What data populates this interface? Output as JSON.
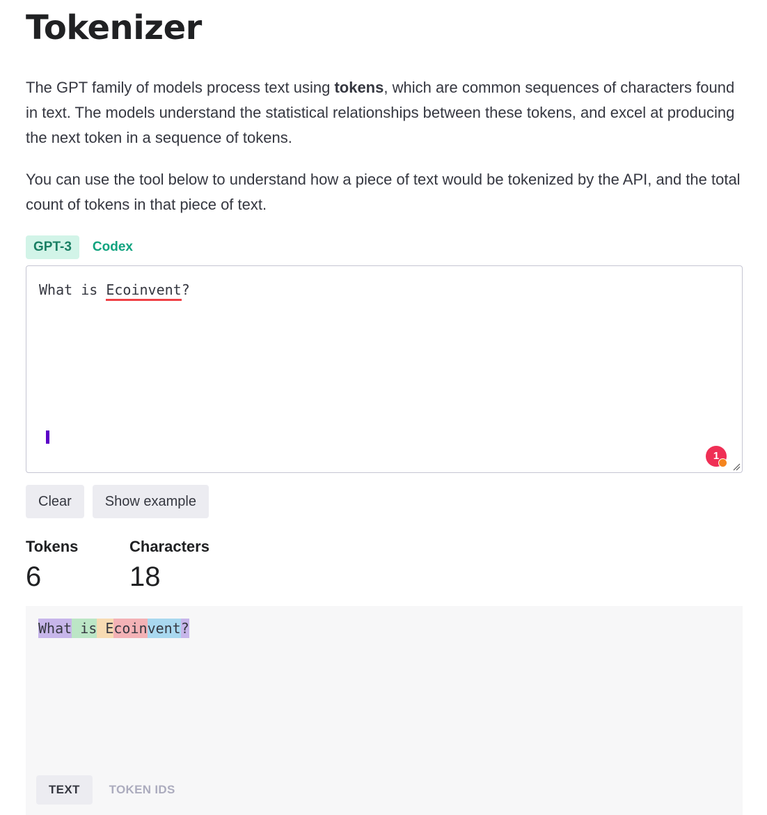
{
  "header": {
    "title": "Tokenizer"
  },
  "intro": {
    "p1_before": "The GPT family of models process text using ",
    "p1_bold": "tokens",
    "p1_after": ", which are common sequences of characters found in text. The models understand the statistical relationships between these tokens, and excel at producing the next token in a sequence of tokens.",
    "p2": "You can use the tool below to understand how a piece of text would be tokenized by the API, and the total count of tokens in that piece of text."
  },
  "model_tabs": [
    {
      "label": "GPT-3",
      "active": true
    },
    {
      "label": "Codex",
      "active": false
    }
  ],
  "editor": {
    "text_before": "What is ",
    "text_flagged": "Ecoinvent",
    "text_after": "?",
    "grammar_badge_count": "1"
  },
  "buttons": {
    "clear": "Clear",
    "show_example": "Show example"
  },
  "stats": {
    "tokens_label": "Tokens",
    "tokens_value": "6",
    "characters_label": "Characters",
    "characters_value": "18"
  },
  "output": {
    "tokens": [
      {
        "text": "What",
        "color": "#c7b6ea"
      },
      {
        "text": " is",
        "color": "#bce6c6"
      },
      {
        "text": " E",
        "color": "#f7dbb3"
      },
      {
        "text": "coin",
        "color": "#f3b2b6"
      },
      {
        "text": "vent",
        "color": "#a9d8ef"
      },
      {
        "text": "?",
        "color": "#c7b6ea"
      }
    ],
    "view_tabs": [
      {
        "label": "TEXT",
        "active": true
      },
      {
        "label": "TOKEN IDS",
        "active": false
      }
    ]
  },
  "colors": {
    "accent": "#10a37f",
    "spell_underline": "#ef4146",
    "caret": "#5b00c7",
    "badge": "#ef2f55"
  },
  "icons": [
    "grammar-badge-icon",
    "resize-handle-icon"
  ]
}
